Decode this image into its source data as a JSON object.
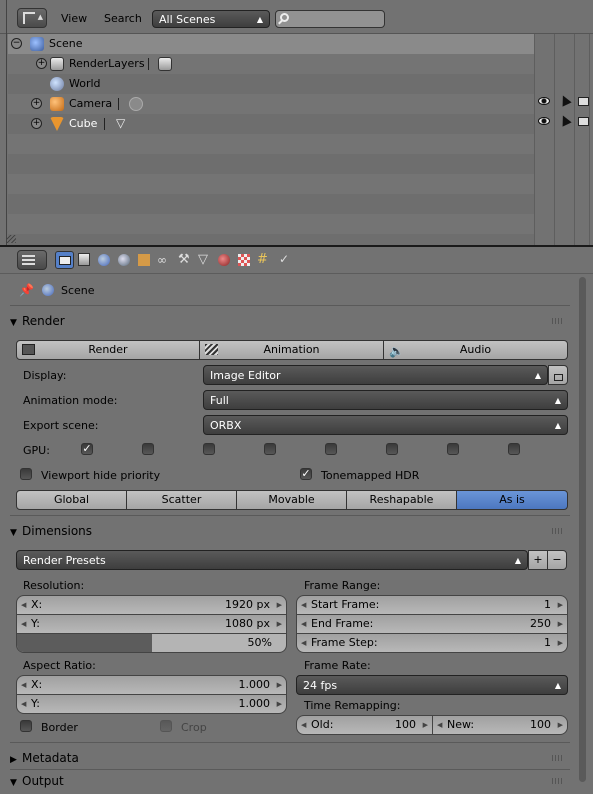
{
  "outliner": {
    "header": {
      "menu_view": "View",
      "menu_search": "Search",
      "display_mode": "All Scenes",
      "search_value": ""
    },
    "tree": [
      {
        "label": "Scene",
        "icon": "scene-icon"
      },
      {
        "label": "RenderLayers",
        "icon": "renderlayers-icon"
      },
      {
        "label": "World",
        "icon": "world-icon"
      },
      {
        "label": "Camera",
        "icon": "camera-object-icon"
      },
      {
        "label": "Cube",
        "icon": "mesh-object-icon"
      }
    ]
  },
  "properties": {
    "context_tabs": [
      "render",
      "render-layers",
      "scene",
      "world",
      "object",
      "constraints",
      "modifiers",
      "data",
      "material",
      "texture",
      "particles",
      "physics"
    ],
    "breadcrumb": "Scene",
    "render_panel": {
      "title": "Render",
      "render_btn": "Render",
      "animation_btn": "Animation",
      "audio_btn": "Audio",
      "display_label": "Display:",
      "display_value": "Image Editor",
      "anim_mode_label": "Animation mode:",
      "anim_mode_value": "Full",
      "export_label": "Export scene:",
      "export_value": "ORBX",
      "gpu_label": "GPU:",
      "gpu_checked": [
        true,
        false,
        false,
        false,
        false,
        false,
        false,
        false
      ],
      "viewport_hide": "Viewport hide priority",
      "tonemapped": "Tonemapped HDR",
      "tonemapped_checked": true,
      "segments": [
        "Global",
        "Scatter",
        "Movable",
        "Reshapable",
        "As is"
      ],
      "active_segment": "As is"
    },
    "dimensions_panel": {
      "title": "Dimensions",
      "presets": "Render Presets",
      "resolution_label": "Resolution:",
      "res_x_label": "X:",
      "res_x": "1920 px",
      "res_y_label": "Y:",
      "res_y": "1080 px",
      "res_pct": "50%",
      "res_pct_value": 0.5,
      "aspect_label": "Aspect Ratio:",
      "asp_x_label": "X:",
      "asp_x": "1.000",
      "asp_y_label": "Y:",
      "asp_y": "1.000",
      "border_label": "Border",
      "crop_label": "Crop",
      "frame_range_label": "Frame Range:",
      "start_label": "Start Frame:",
      "start": "1",
      "end_label": "End Frame:",
      "end": "250",
      "step_label": "Frame Step:",
      "step": "1",
      "frame_rate_label": "Frame Rate:",
      "frame_rate": "24 fps",
      "time_remap_label": "Time Remapping:",
      "old_label": "Old:",
      "old": "100",
      "new_label": "New:",
      "new": "100"
    },
    "metadata_panel": {
      "title": "Metadata"
    },
    "output_panel": {
      "title": "Output"
    }
  },
  "colors": {
    "accent": "#5680c2",
    "bg": "#727272"
  }
}
